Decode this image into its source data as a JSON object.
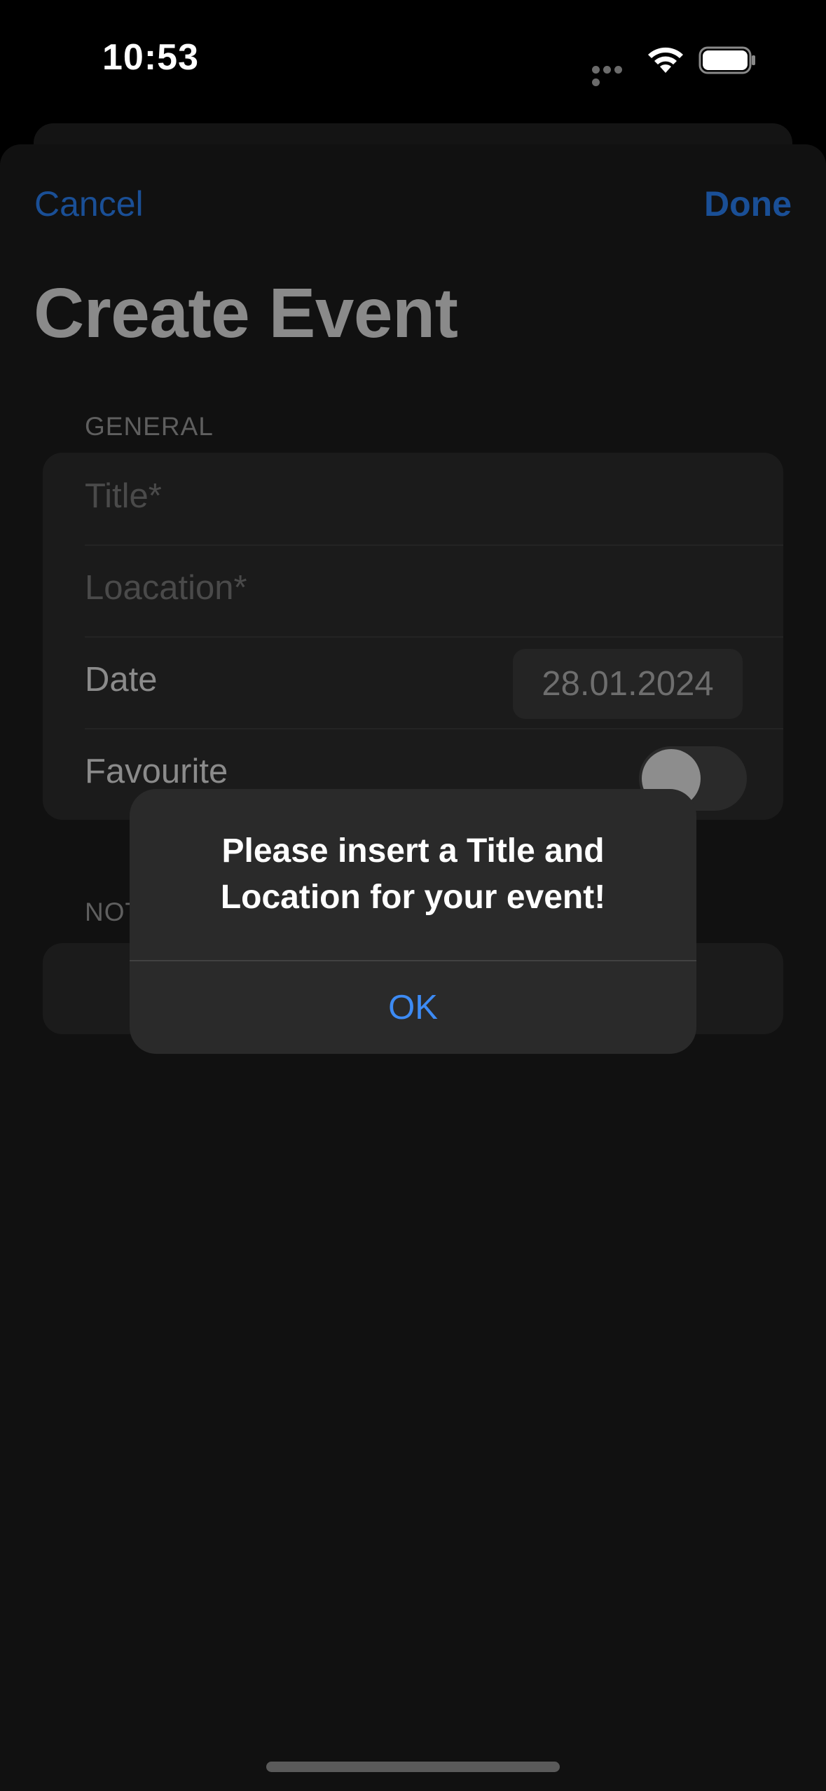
{
  "status_bar": {
    "time": "10:53",
    "icons": [
      "signal-dots-icon",
      "wifi-icon",
      "battery-icon"
    ]
  },
  "nav": {
    "cancel_label": "Cancel",
    "done_label": "Done"
  },
  "page": {
    "title": "Create Event"
  },
  "general_section": {
    "header": "GENERAL",
    "title_placeholder": "Title*",
    "location_placeholder": "Loacation*",
    "date_label": "Date",
    "date_value": "28.01.2024",
    "favourite_label": "Favourite",
    "favourite_on": false
  },
  "notes_section": {
    "header_visible": "NOT"
  },
  "alert": {
    "message_line1": "Please insert a Title and",
    "message_line2": "Location for your event!",
    "ok_label": "OK"
  },
  "colors": {
    "accent": "#3d8bf4",
    "dimmed_accent": "#1a4f96",
    "background": "#111111",
    "alert_background": "#2a2a2a"
  }
}
